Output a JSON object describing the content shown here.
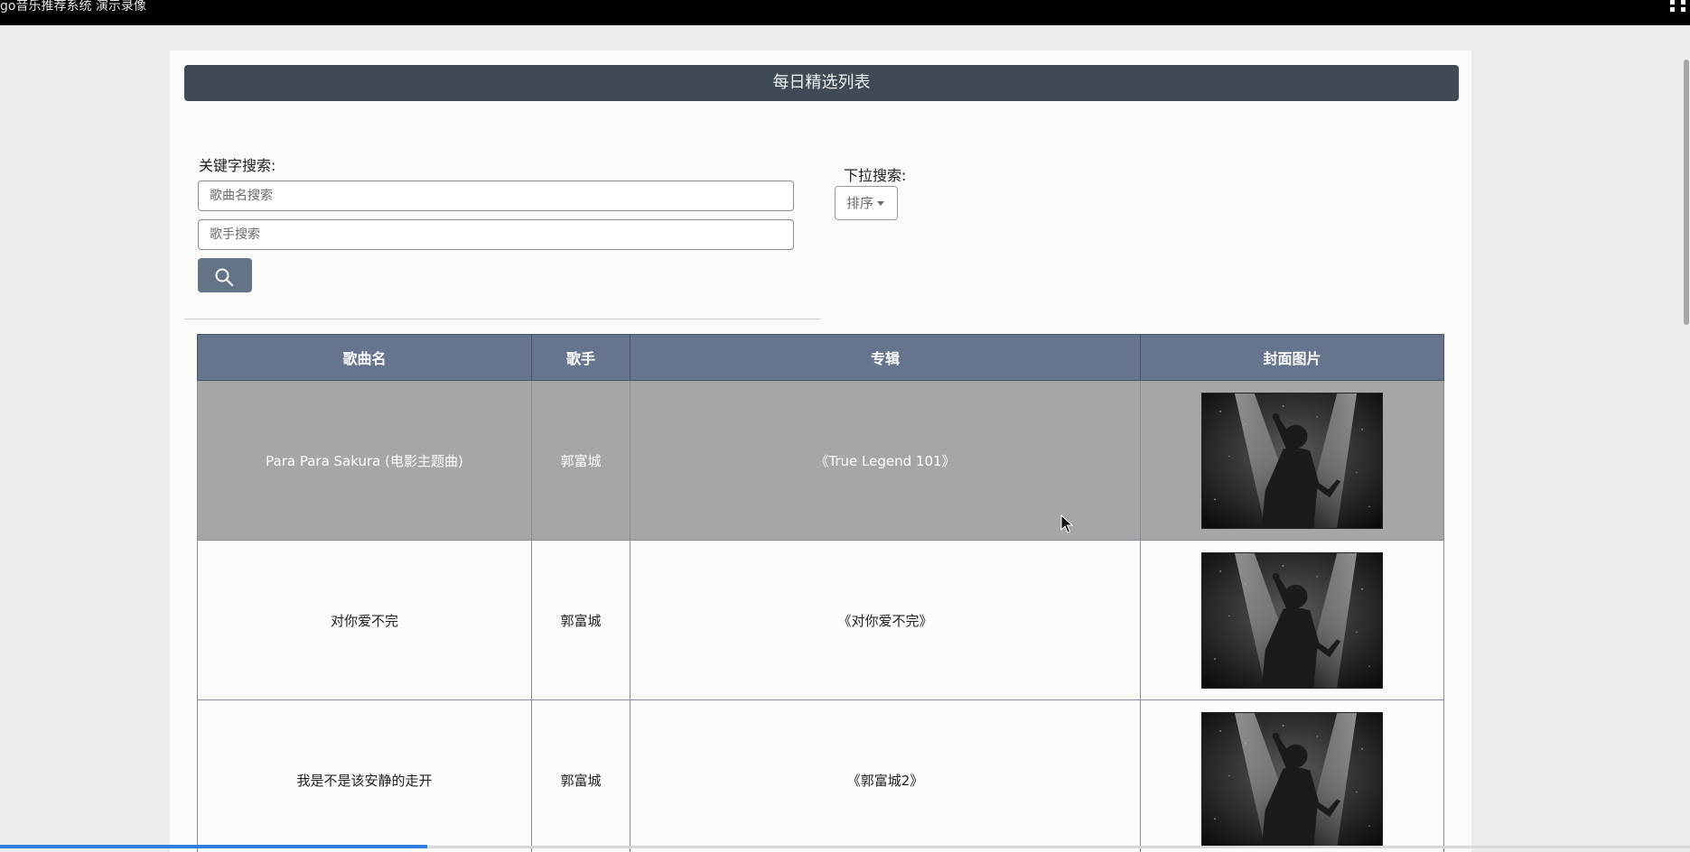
{
  "video": {
    "title": "go音乐推荐系统 演示录像",
    "progress_fraction": 0.253
  },
  "header": {
    "title": "每日精选列表"
  },
  "search": {
    "keyword_label": "关键字搜索:",
    "song_placeholder": "歌曲名搜索",
    "singer_placeholder": "歌手搜索",
    "button_icon": "search-icon",
    "dropdown_label": "下拉搜索:",
    "sort_label": "排序"
  },
  "table": {
    "headers": [
      "歌曲名",
      "歌手",
      "专辑",
      "封面图片"
    ],
    "rows": [
      {
        "song": "Para Para Sakura (电影主题曲)",
        "singer": "郭富城",
        "album": "《True Legend 101》",
        "highlighted": true
      },
      {
        "song": "对你爱不完",
        "singer": "郭富城",
        "album": "《对你爱不完》",
        "highlighted": false
      },
      {
        "song": "我是不是该安静的走开",
        "singer": "郭富城",
        "album": "《郭富城2》",
        "highlighted": false
      }
    ]
  },
  "colors": {
    "header_bar": "#3f4a54",
    "table_header": "#66748e",
    "search_button": "#657389",
    "row_highlight": "#a5a6a7",
    "progress": "#2f7de1"
  }
}
